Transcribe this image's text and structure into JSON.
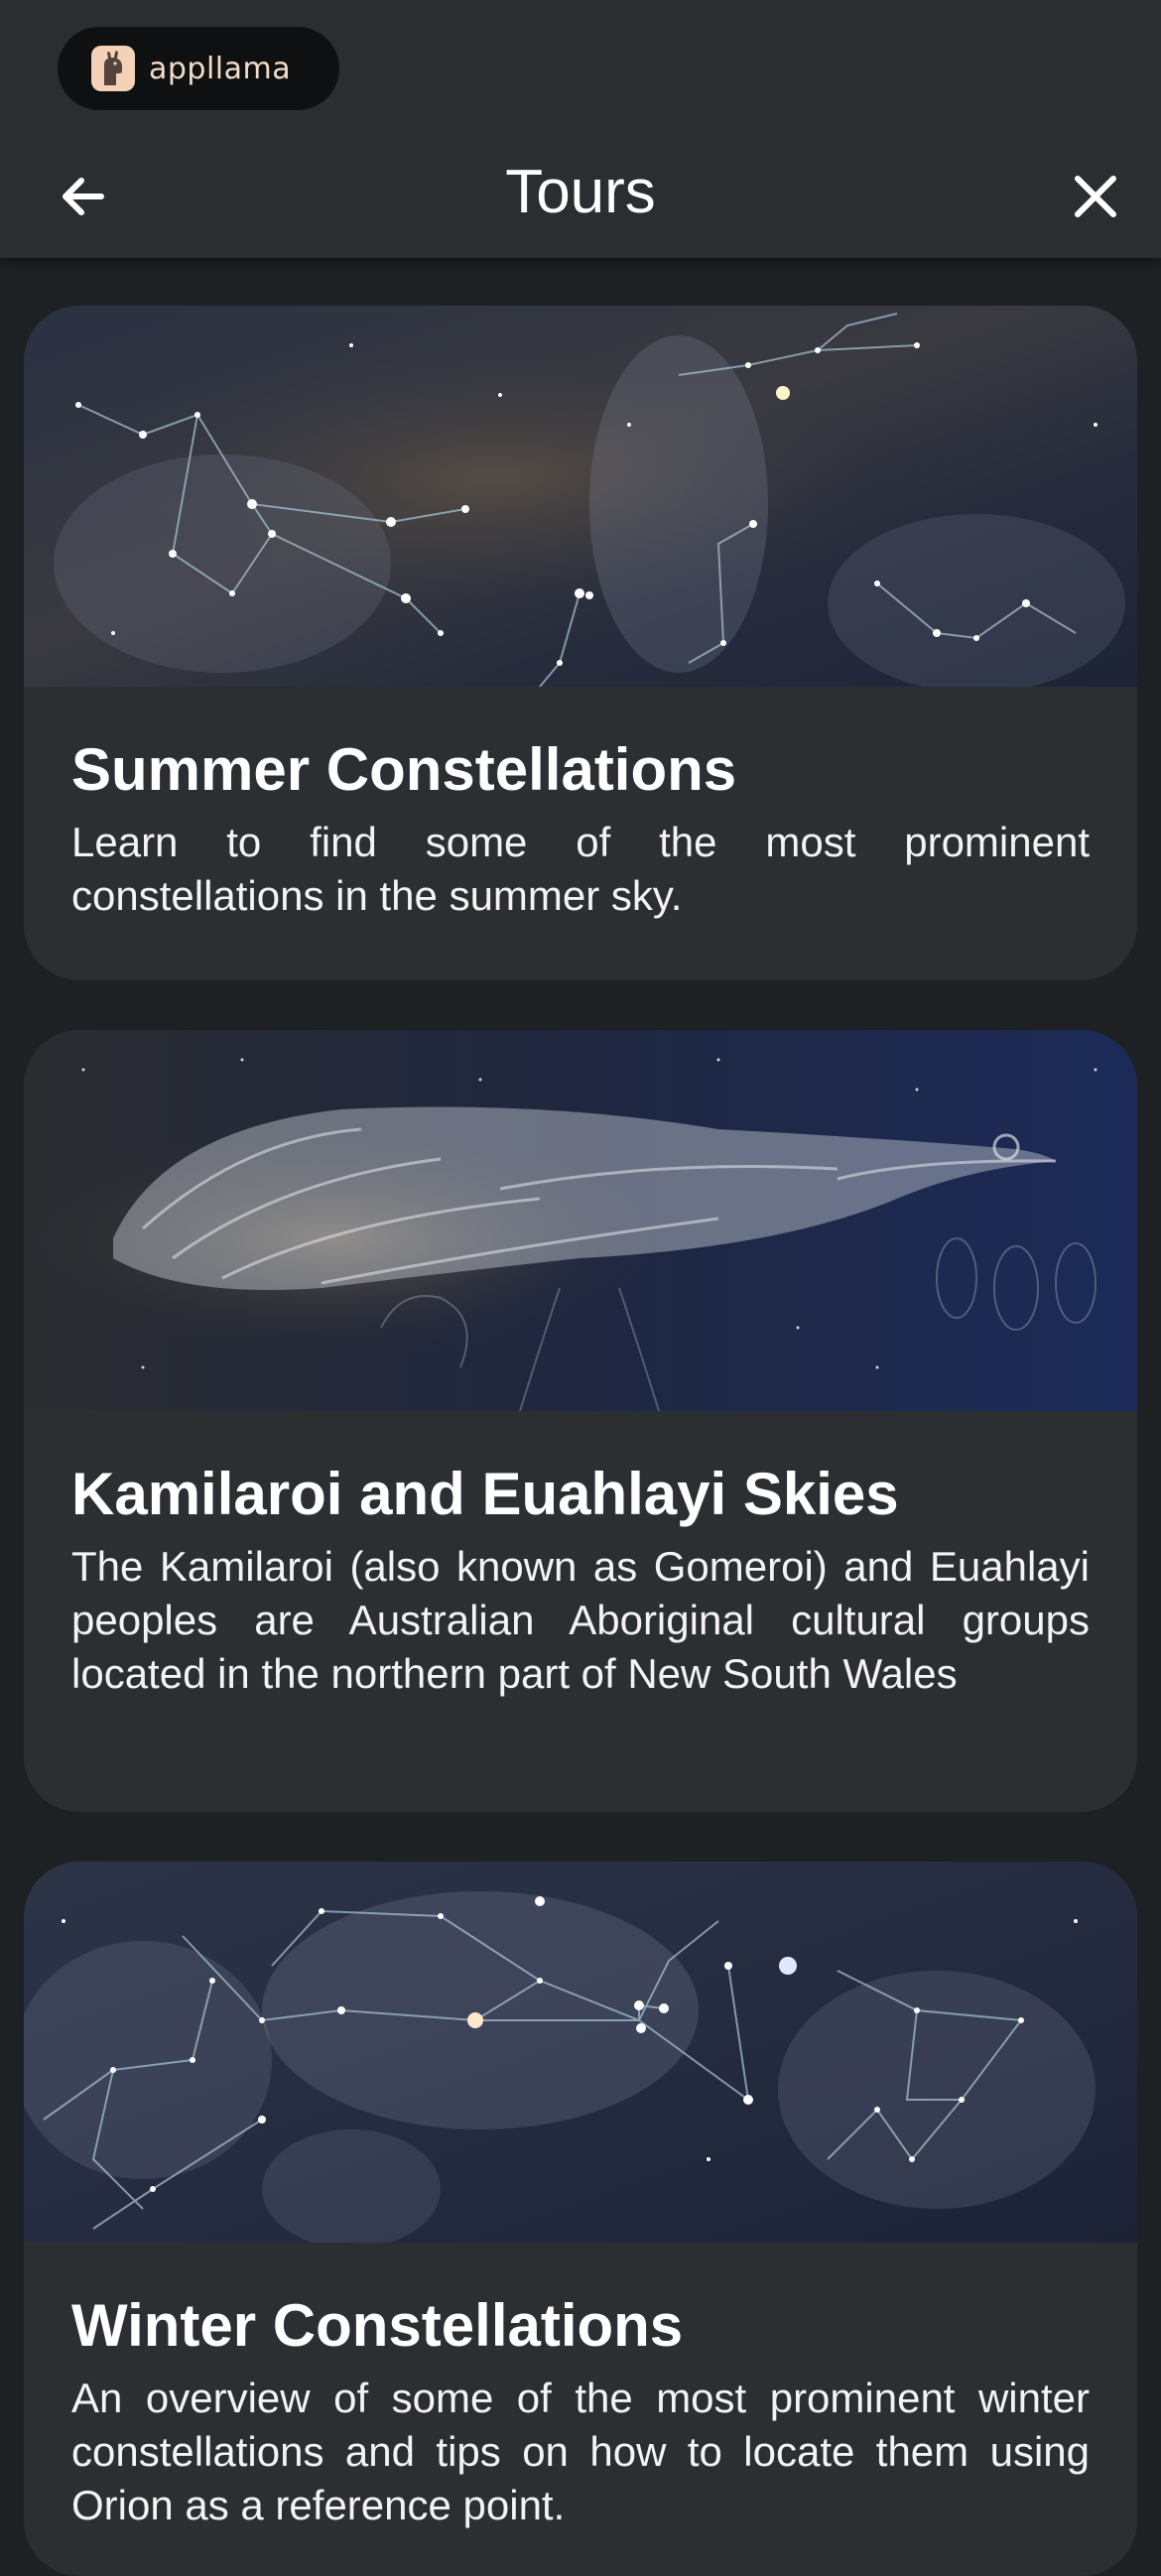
{
  "brand": {
    "name": "appllama"
  },
  "header": {
    "title": "Tours",
    "back_icon": "arrow-left-icon",
    "close_icon": "close-icon"
  },
  "colors": {
    "header_bg": "#2b2e31",
    "page_bg": "#1e2124",
    "card_bg": "#2c2f32",
    "brand_pill_bg": "#0f1011",
    "brand_accent": "#f3d2b8"
  },
  "tours": [
    {
      "title": "Summer Constellations",
      "description": "Learn to find some of the most prominent constellations in the summer sky."
    },
    {
      "title": "Kamilaroi and Euahlayi Skies",
      "description": "The Kamilaroi (also known as Gomeroi) and Euahlayi peoples are Australian Aboriginal cultural groups located in the northern part of New South Wales"
    },
    {
      "title": "Winter Constellations",
      "description": "An overview of some of the most prominent winter constellations and tips on how to locate them using Orion as a reference point."
    }
  ]
}
